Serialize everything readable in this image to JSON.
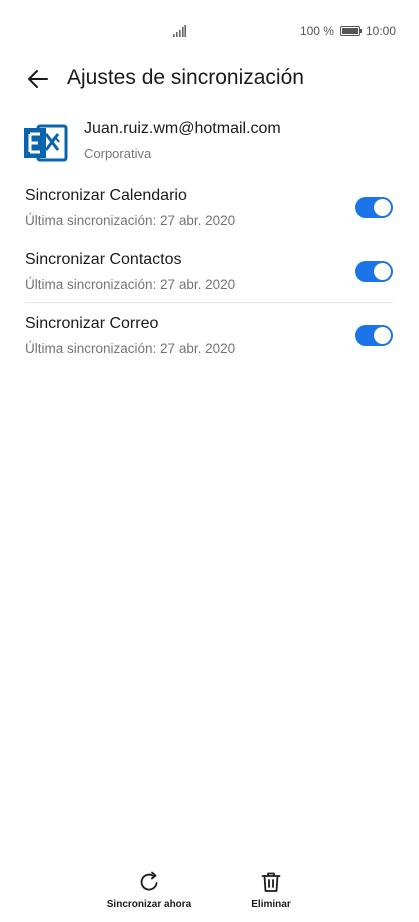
{
  "status_bar": {
    "battery_percent": "100 %",
    "time": "10:00"
  },
  "header": {
    "title": "Ajustes de sincronización",
    "back_icon": "arrow-left-icon"
  },
  "account": {
    "icon": "exchange-icon",
    "email": "Juan.ruiz.wm@hotmail.com",
    "type": "Corporativa"
  },
  "sync_items": [
    {
      "title": "Sincronizar Calendario",
      "subtitle": "Última sincronización: 27 abr. 2020",
      "enabled": true
    },
    {
      "title": "Sincronizar Contactos",
      "subtitle": "Última sincronización: 27 abr. 2020",
      "enabled": true
    },
    {
      "title": "Sincronizar Correo",
      "subtitle": "Última sincronización: 27 abr. 2020",
      "enabled": true
    }
  ],
  "bottom_bar": {
    "sync_now_label": "Sincronizar ahora",
    "sync_now_icon": "refresh-icon",
    "delete_label": "Eliminar",
    "delete_icon": "trash-icon"
  },
  "colors": {
    "accent": "#1a73e8",
    "exchange_blue": "#0a64ad",
    "secondary_text": "#757575"
  }
}
